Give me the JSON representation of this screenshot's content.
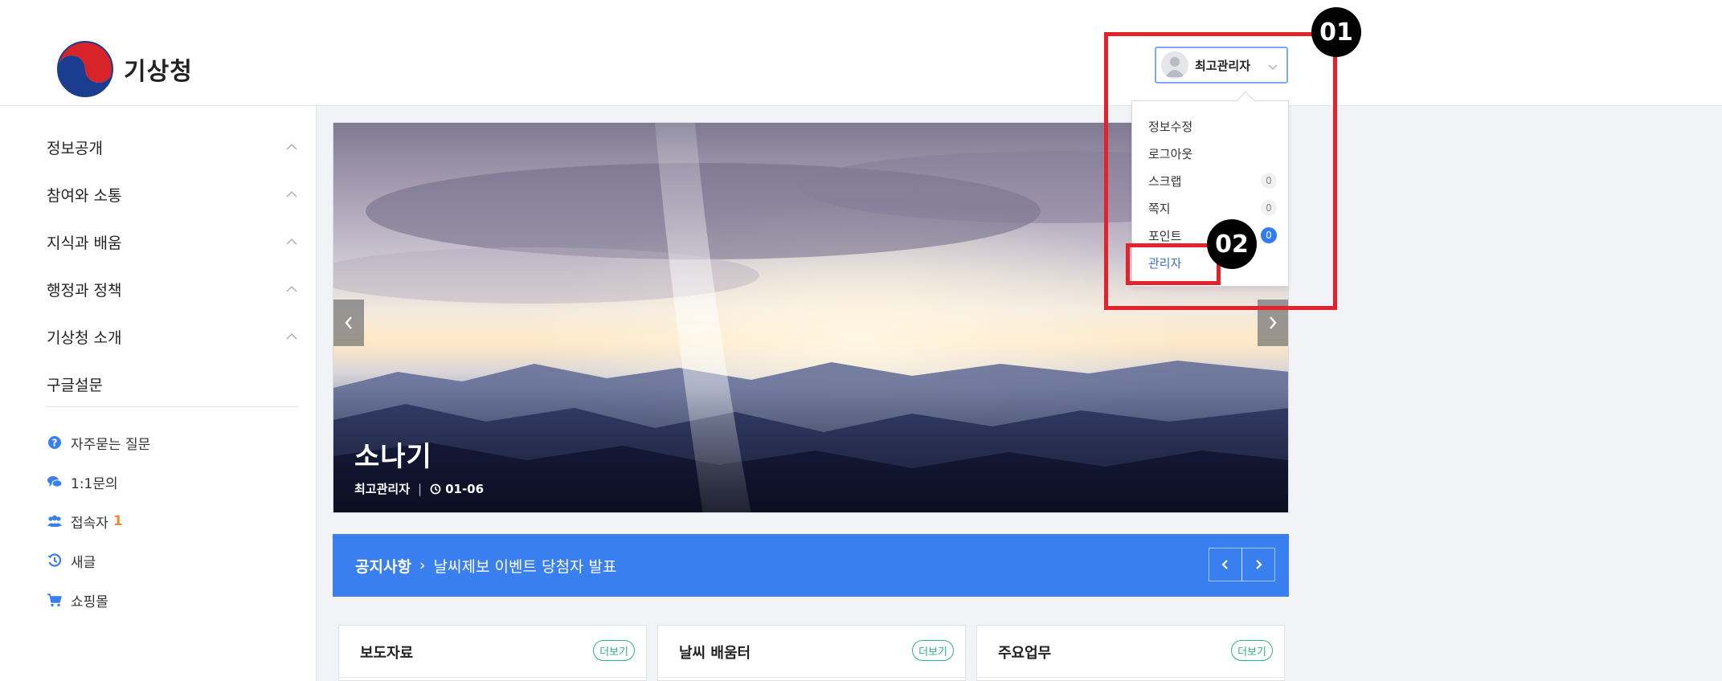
{
  "header": {
    "logo_text": "기상청",
    "user": {
      "name": "최고관리자"
    }
  },
  "user_menu": {
    "items": [
      {
        "label": "정보수정",
        "count": ""
      },
      {
        "label": "로그아웃",
        "count": ""
      },
      {
        "label": "스크랩",
        "count": "0"
      },
      {
        "label": "쪽지",
        "count": "0"
      },
      {
        "label": "포인트",
        "count": "0"
      },
      {
        "label": "관리자",
        "count": ""
      }
    ]
  },
  "sidebar": {
    "menu": [
      {
        "label": "정보공개"
      },
      {
        "label": "참여와 소통"
      },
      {
        "label": "지식과 배움"
      },
      {
        "label": "행정과 정책"
      },
      {
        "label": "기상청 소개"
      },
      {
        "label": "구글설문"
      }
    ],
    "quick": [
      {
        "label": "자주묻는 질문",
        "icon": "question-circle-icon",
        "count": ""
      },
      {
        "label": "1:1문의",
        "icon": "chat-bubbles-icon",
        "count": ""
      },
      {
        "label": "접속자",
        "icon": "users-icon",
        "count": "1"
      },
      {
        "label": "새글",
        "icon": "history-icon",
        "count": ""
      },
      {
        "label": "쇼핑몰",
        "icon": "cart-icon",
        "count": ""
      }
    ]
  },
  "banner": {
    "title": "소나기",
    "author": "최고관리자",
    "date": "01-06"
  },
  "notice": {
    "title": "공지사항",
    "text": "날씨제보 이벤트 당첨자 발표"
  },
  "boards": [
    {
      "title": "보도자료",
      "more": "더보기"
    },
    {
      "title": "날씨 배움터",
      "more": "더보기"
    },
    {
      "title": "주요업무",
      "more": "더보기"
    }
  ],
  "annotations": {
    "badge_1": "01",
    "badge_2": "02"
  },
  "colors": {
    "accent_blue": "#3a7ff0",
    "annotation_red": "#e3222b",
    "more_green": "#2fb27f",
    "visitor_orange": "#f0893a"
  }
}
